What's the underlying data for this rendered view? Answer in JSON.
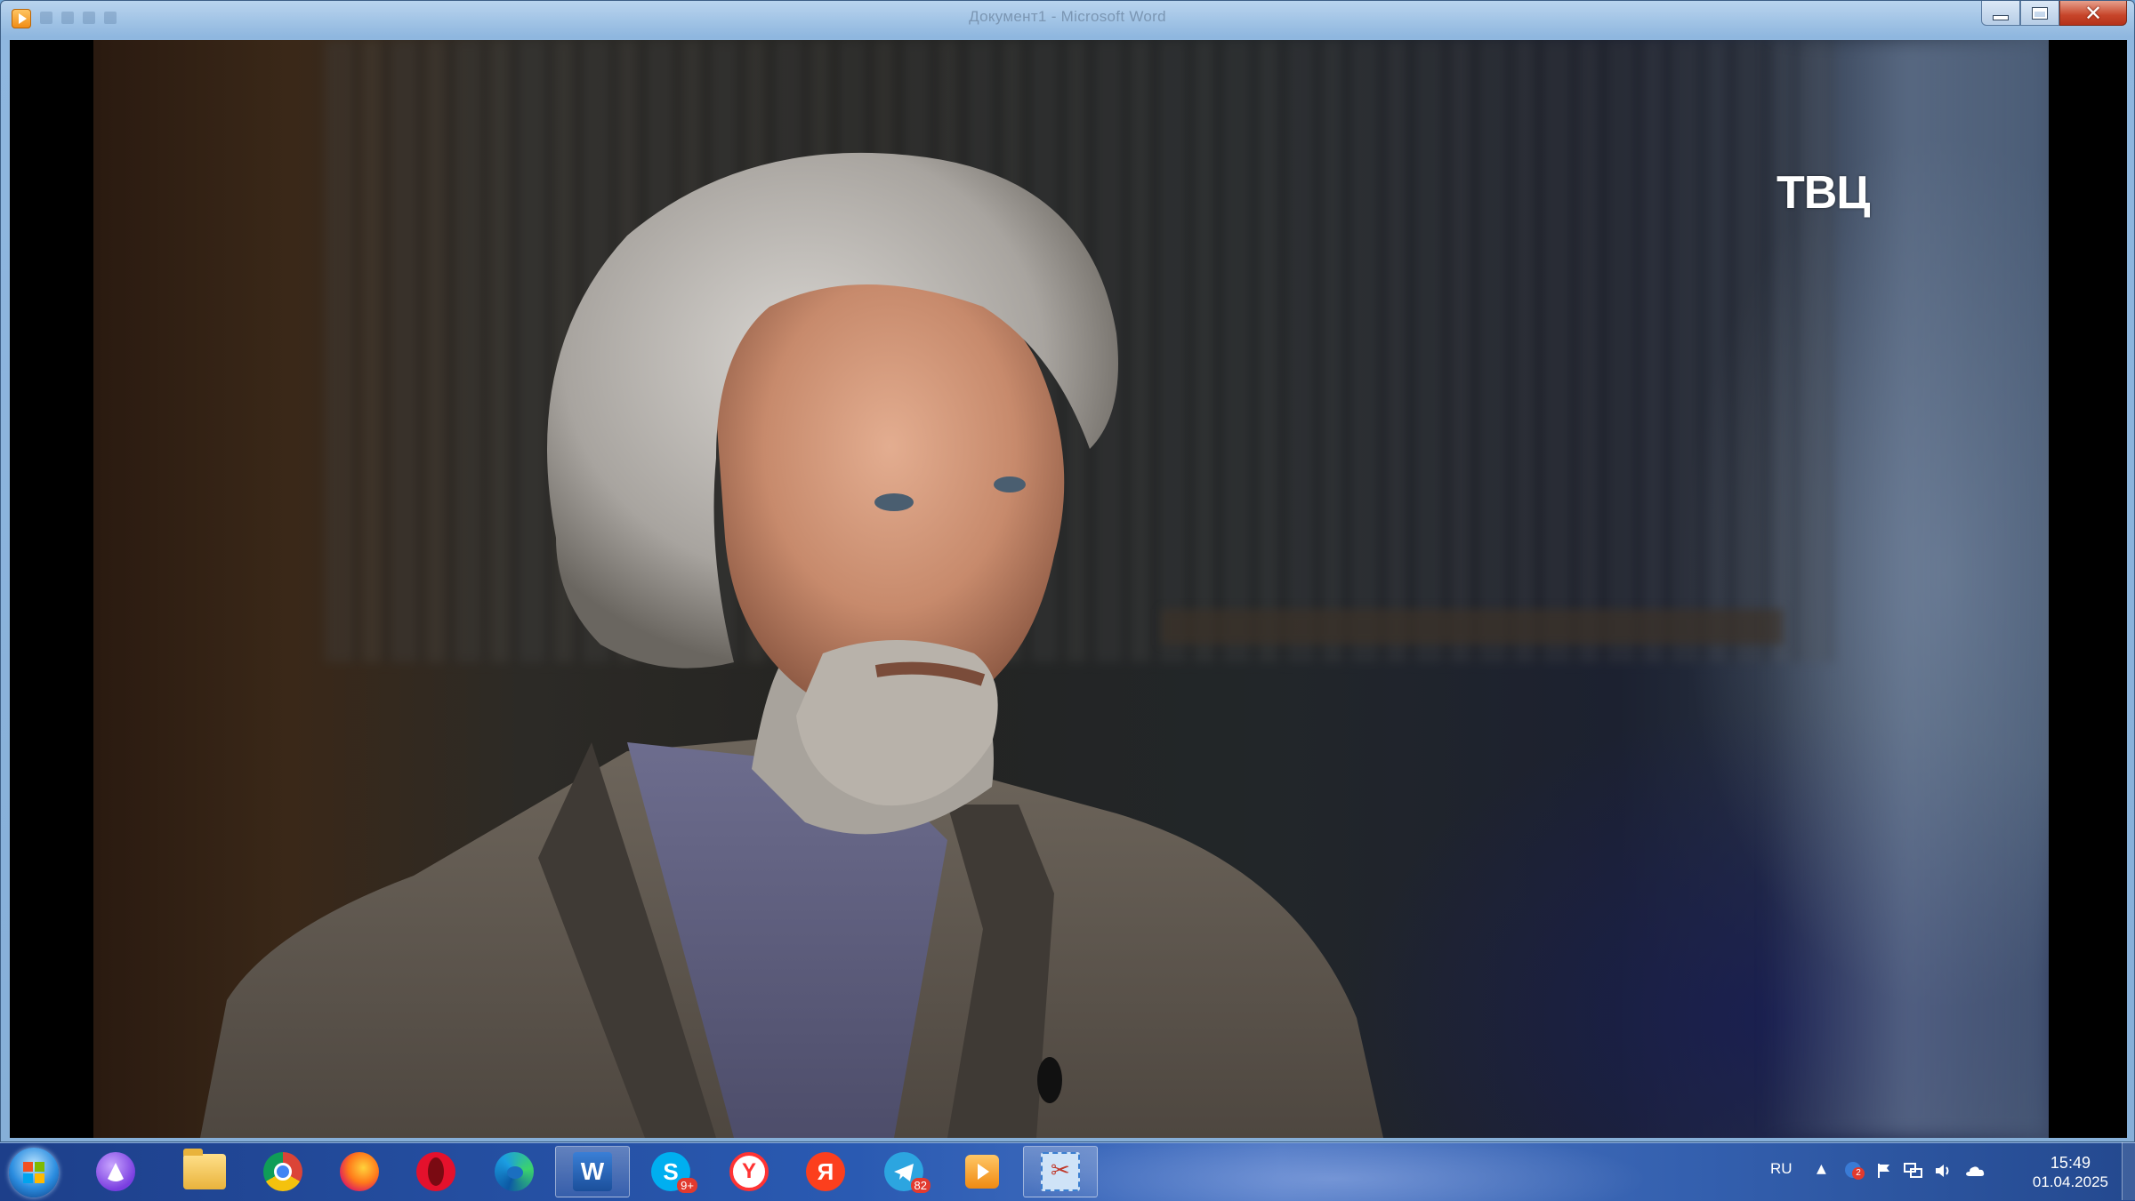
{
  "window": {
    "title": "Документ1 - Microsoft Word",
    "controls": [
      "minimize",
      "maximize",
      "close"
    ]
  },
  "video": {
    "channel_logo": "ТВЦ"
  },
  "taskbar": {
    "apps": [
      {
        "name": "alice-icon"
      },
      {
        "name": "file-explorer-icon"
      },
      {
        "name": "chrome-icon"
      },
      {
        "name": "firefox-icon"
      },
      {
        "name": "opera-icon"
      },
      {
        "name": "edge-icon"
      },
      {
        "name": "word-icon",
        "active": true
      },
      {
        "name": "skype-icon",
        "badge": "9+"
      },
      {
        "name": "yandex-browser-icon"
      },
      {
        "name": "yandex-icon"
      },
      {
        "name": "telegram-icon",
        "badge": "82"
      },
      {
        "name": "media-player-icon"
      },
      {
        "name": "snipping-tool-icon",
        "active": true
      }
    ],
    "accent": "#2a5ab2"
  },
  "tray": {
    "language": "RU",
    "icons": [
      "show-hidden-icons-arrow-icon",
      "antivirus-icon",
      "action-center-flag-icon",
      "network-icon",
      "volume-icon",
      "cloud-icon"
    ],
    "antivirus_badge": "2",
    "time": "15:49",
    "date": "01.04.2025"
  }
}
